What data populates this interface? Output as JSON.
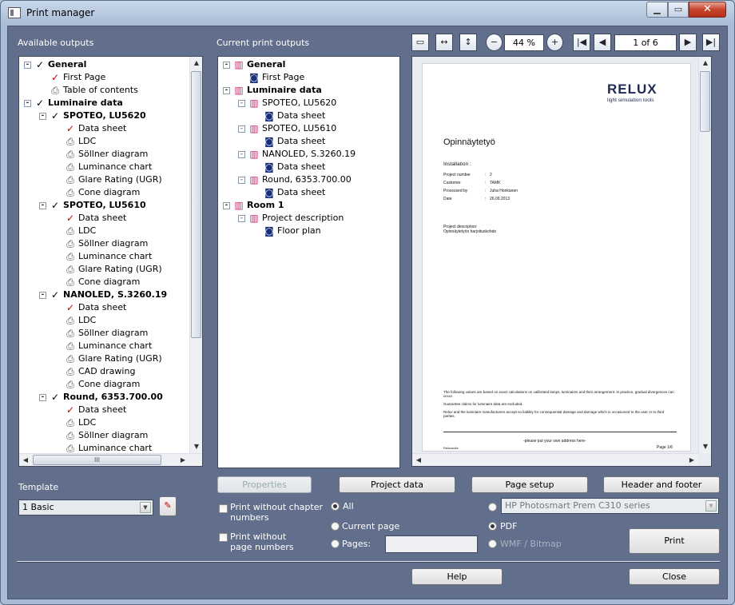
{
  "window": {
    "title": "Print manager"
  },
  "left": {
    "available_label": "Available outputs",
    "available_tree": [
      {
        "t": "General",
        "b": true,
        "i": "chk",
        "l": 0,
        "e": "-"
      },
      {
        "t": "First Page",
        "i": "chkr",
        "l": 1
      },
      {
        "t": "Table of contents",
        "i": "prn",
        "l": 1
      },
      {
        "t": "Luminaire data",
        "b": true,
        "i": "chk",
        "l": 0,
        "e": "-"
      },
      {
        "t": "SPOTEO, LU5620",
        "b": true,
        "i": "chk",
        "l": 1,
        "e": "-"
      },
      {
        "t": "Data sheet",
        "i": "chkr",
        "l": 2
      },
      {
        "t": "LDC",
        "i": "prn",
        "l": 2
      },
      {
        "t": "Söllner diagram",
        "i": "prn",
        "l": 2
      },
      {
        "t": "Luminance chart",
        "i": "prn",
        "l": 2
      },
      {
        "t": "Glare Rating (UGR)",
        "i": "prn",
        "l": 2
      },
      {
        "t": "Cone diagram",
        "i": "prn",
        "l": 2
      },
      {
        "t": "SPOTEO, LU5610",
        "b": true,
        "i": "chk",
        "l": 1,
        "e": "-"
      },
      {
        "t": "Data sheet",
        "i": "chkr",
        "l": 2
      },
      {
        "t": "LDC",
        "i": "prn",
        "l": 2
      },
      {
        "t": "Söllner diagram",
        "i": "prn",
        "l": 2
      },
      {
        "t": "Luminance chart",
        "i": "prn",
        "l": 2
      },
      {
        "t": "Glare Rating (UGR)",
        "i": "prn",
        "l": 2
      },
      {
        "t": "Cone diagram",
        "i": "prn",
        "l": 2
      },
      {
        "t": "NANOLED,  S.3260.19",
        "b": true,
        "i": "chk",
        "l": 1,
        "e": "-"
      },
      {
        "t": "Data sheet",
        "i": "chkr",
        "l": 2
      },
      {
        "t": "LDC",
        "i": "prn",
        "l": 2
      },
      {
        "t": "Söllner diagram",
        "i": "prn",
        "l": 2
      },
      {
        "t": "Luminance chart",
        "i": "prn",
        "l": 2
      },
      {
        "t": "Glare Rating (UGR)",
        "i": "prn",
        "l": 2
      },
      {
        "t": "CAD drawing",
        "i": "prn",
        "l": 2
      },
      {
        "t": "Cone diagram",
        "i": "prn",
        "l": 2
      },
      {
        "t": "Round, 6353.700.00",
        "b": true,
        "i": "chk",
        "l": 1,
        "e": "-"
      },
      {
        "t": "Data sheet",
        "i": "chkr",
        "l": 2
      },
      {
        "t": "LDC",
        "i": "prn",
        "l": 2
      },
      {
        "t": "Söllner diagram",
        "i": "prn",
        "l": 2
      },
      {
        "t": "Luminance chart",
        "i": "prn",
        "l": 2
      }
    ],
    "template_label": "Template",
    "template_value": "1 Basic"
  },
  "middle": {
    "current_label": "Current print outputs",
    "current_tree": [
      {
        "t": "General",
        "b": true,
        "i": "book",
        "l": 0,
        "e": "-"
      },
      {
        "t": "First Page",
        "i": "doc",
        "l": 1
      },
      {
        "t": "Luminaire data",
        "b": true,
        "i": "book",
        "l": 0,
        "e": "-"
      },
      {
        "t": "SPOTEO, LU5620",
        "i": "book",
        "l": 1,
        "e": "-"
      },
      {
        "t": "Data sheet",
        "i": "doc",
        "l": 2
      },
      {
        "t": "SPOTEO, LU5610",
        "i": "book",
        "l": 1,
        "e": "-"
      },
      {
        "t": "Data sheet",
        "i": "doc",
        "l": 2
      },
      {
        "t": "NANOLED,  S.3260.19",
        "i": "book",
        "l": 1,
        "e": "-"
      },
      {
        "t": "Data sheet",
        "i": "doc",
        "l": 2
      },
      {
        "t": "Round, 6353.700.00",
        "i": "book",
        "l": 1,
        "e": "-"
      },
      {
        "t": "Data sheet",
        "i": "doc",
        "l": 2
      },
      {
        "t": "Room 1",
        "b": true,
        "i": "book",
        "l": 0,
        "e": "-"
      },
      {
        "t": "Project description",
        "i": "book",
        "l": 1,
        "e": "-"
      },
      {
        "t": "Floor plan",
        "i": "doc",
        "l": 2
      }
    ]
  },
  "toolbar": {
    "zoom": "44 %",
    "page": "1 of 6"
  },
  "preview": {
    "logo_top": "RELUX",
    "logo_sub": "light simulation tools",
    "heading": "Opinnäytetyö",
    "installation": "Installation         :",
    "rows": [
      [
        "Project number",
        "2"
      ],
      [
        "Customer",
        "TAMK"
      ],
      [
        "Processed by",
        "Juha Honkanen"
      ],
      [
        "Date",
        "26.09.2013"
      ]
    ],
    "proj_desc_1": "Project description:",
    "proj_desc_2": "Opinnäytetyön harjoituskohde",
    "footnote_1": "The following values are based on exact calculations on calibrated lamps, luminaires and their arrangement. In practice, gradual divergences can occur.",
    "footnote_2": "Guarantee claims for luminaire data are excluded.",
    "footnote_3": "Relux and the luminaire manufacturers accept no liability for consequential damage and damage which is occasioned to the user or to third parties.",
    "address": "-please put your own address here-",
    "footer_left": "Reluxsuite",
    "footer_right": "Page 1/6"
  },
  "buttons": {
    "properties": "Properties",
    "project_data": "Project data",
    "page_setup": "Page setup",
    "header_footer": "Header and footer",
    "print": "Print",
    "help": "Help",
    "close": "Close"
  },
  "options": {
    "no_chapter": "Print without chapter numbers",
    "no_page": "Print without page numbers",
    "all": "All",
    "current_page": "Current page",
    "pages": "Pages:",
    "printer": "HP Photosmart Prem C310 series",
    "pdf": "PDF",
    "wmf": "WMF / Bitmap"
  }
}
